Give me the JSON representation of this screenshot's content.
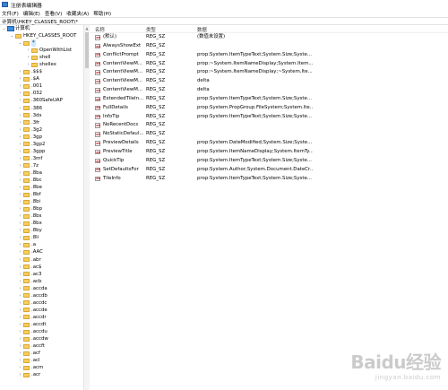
{
  "window": {
    "title": "注册表编辑器"
  },
  "menu": [
    "文件(F)",
    "编辑(E)",
    "查看(V)",
    "收藏夹(A)",
    "帮助(H)"
  ],
  "address": "计算机\\HKEY_CLASSES_ROOT\\*",
  "tree": [
    {
      "label": "计算机",
      "indent": 0,
      "expanded": true,
      "icon": "computer"
    },
    {
      "label": "HKEY_CLASSES_ROOT",
      "indent": 1,
      "expanded": true,
      "icon": "folder"
    },
    {
      "label": "*",
      "indent": 2,
      "expanded": true,
      "icon": "folder",
      "selected": true
    },
    {
      "label": "OpenWithList",
      "indent": 3,
      "expanded": false,
      "icon": "folder"
    },
    {
      "label": "shell",
      "indent": 3,
      "expanded": false,
      "icon": "folder"
    },
    {
      "label": "shellex",
      "indent": 3,
      "expanded": false,
      "icon": "folder"
    },
    {
      "label": ".$$$",
      "indent": 2,
      "expanded": false,
      "icon": "folder"
    },
    {
      "label": ".$A",
      "indent": 2,
      "expanded": false,
      "icon": "folder"
    },
    {
      "label": ".001",
      "indent": 2,
      "expanded": false,
      "icon": "folder"
    },
    {
      "label": ".032",
      "indent": 2,
      "expanded": false,
      "icon": "folder"
    },
    {
      "label": ".360SafeUAP",
      "indent": 2,
      "expanded": false,
      "icon": "folder"
    },
    {
      "label": ".386",
      "indent": 2,
      "expanded": false,
      "icon": "folder"
    },
    {
      "label": ".3ds",
      "indent": 2,
      "expanded": false,
      "icon": "folder"
    },
    {
      "label": ".3fr",
      "indent": 2,
      "expanded": false,
      "icon": "folder"
    },
    {
      "label": ".3g2",
      "indent": 2,
      "expanded": false,
      "icon": "folder"
    },
    {
      "label": ".3gp",
      "indent": 2,
      "expanded": false,
      "icon": "folder"
    },
    {
      "label": ".3gp2",
      "indent": 2,
      "expanded": false,
      "icon": "folder"
    },
    {
      "label": ".3gpp",
      "indent": 2,
      "expanded": false,
      "icon": "folder"
    },
    {
      "label": ".3mf",
      "indent": 2,
      "expanded": false,
      "icon": "folder"
    },
    {
      "label": ".7z",
      "indent": 2,
      "expanded": false,
      "icon": "folder"
    },
    {
      "label": ".8ba",
      "indent": 2,
      "expanded": false,
      "icon": "folder"
    },
    {
      "label": ".8bc",
      "indent": 2,
      "expanded": false,
      "icon": "folder"
    },
    {
      "label": ".8be",
      "indent": 2,
      "expanded": false,
      "icon": "folder"
    },
    {
      "label": ".8bf",
      "indent": 2,
      "expanded": false,
      "icon": "folder"
    },
    {
      "label": ".8bi",
      "indent": 2,
      "expanded": false,
      "icon": "folder"
    },
    {
      "label": ".8bp",
      "indent": 2,
      "expanded": false,
      "icon": "folder"
    },
    {
      "label": ".8bs",
      "indent": 2,
      "expanded": false,
      "icon": "folder"
    },
    {
      "label": ".8bx",
      "indent": 2,
      "expanded": false,
      "icon": "folder"
    },
    {
      "label": ".8by",
      "indent": 2,
      "expanded": false,
      "icon": "folder"
    },
    {
      "label": ".8li",
      "indent": 2,
      "expanded": false,
      "icon": "folder"
    },
    {
      "label": ".a",
      "indent": 2,
      "expanded": false,
      "icon": "folder"
    },
    {
      "label": ".AAC",
      "indent": 2,
      "expanded": false,
      "icon": "folder"
    },
    {
      "label": ".abr",
      "indent": 2,
      "expanded": false,
      "icon": "folder"
    },
    {
      "label": ".ac$",
      "indent": 2,
      "expanded": false,
      "icon": "folder"
    },
    {
      "label": ".ac3",
      "indent": 2,
      "expanded": false,
      "icon": "folder"
    },
    {
      "label": ".acb",
      "indent": 2,
      "expanded": false,
      "icon": "folder"
    },
    {
      "label": ".accda",
      "indent": 2,
      "expanded": false,
      "icon": "folder"
    },
    {
      "label": ".accdb",
      "indent": 2,
      "expanded": false,
      "icon": "folder"
    },
    {
      "label": ".accdc",
      "indent": 2,
      "expanded": false,
      "icon": "folder"
    },
    {
      "label": ".accde",
      "indent": 2,
      "expanded": false,
      "icon": "folder"
    },
    {
      "label": ".accdr",
      "indent": 2,
      "expanded": false,
      "icon": "folder"
    },
    {
      "label": ".accdt",
      "indent": 2,
      "expanded": false,
      "icon": "folder"
    },
    {
      "label": ".accdu",
      "indent": 2,
      "expanded": false,
      "icon": "folder"
    },
    {
      "label": ".accdw",
      "indent": 2,
      "expanded": false,
      "icon": "folder"
    },
    {
      "label": ".accft",
      "indent": 2,
      "expanded": false,
      "icon": "folder"
    },
    {
      "label": ".acf",
      "indent": 2,
      "expanded": false,
      "icon": "folder"
    },
    {
      "label": ".acl",
      "indent": 2,
      "expanded": false,
      "icon": "folder"
    },
    {
      "label": ".acm",
      "indent": 2,
      "expanded": false,
      "icon": "folder"
    },
    {
      "label": ".acr",
      "indent": 2,
      "expanded": false,
      "icon": "folder"
    }
  ],
  "columns": {
    "name": "名称",
    "type": "类型",
    "data": "数据"
  },
  "values": [
    {
      "name": "(默认)",
      "type": "REG_SZ",
      "data": "(数值未设置)"
    },
    {
      "name": "AlwaysShowExt",
      "type": "REG_SZ",
      "data": ""
    },
    {
      "name": "ConflictPrompt",
      "type": "REG_SZ",
      "data": "prop:System.ItemTypeText;System.Size;Syste..."
    },
    {
      "name": "ContentViewM...",
      "type": "REG_SZ",
      "data": "prop:~System.ItemNameDisplay;System.Item..."
    },
    {
      "name": "ContentViewM...",
      "type": "REG_SZ",
      "data": "prop:~System.ItemNameDisplay;~System.Ite..."
    },
    {
      "name": "ContentViewM...",
      "type": "REG_SZ",
      "data": "delta"
    },
    {
      "name": "ContentViewM...",
      "type": "REG_SZ",
      "data": "delta"
    },
    {
      "name": "ExtendedTileIn...",
      "type": "REG_SZ",
      "data": "prop:System.ItemTypeText;System.Size;Syste..."
    },
    {
      "name": "FullDetails",
      "type": "REG_SZ",
      "data": "prop:System.PropGroup.FileSystem;System.Ite..."
    },
    {
      "name": "InfoTip",
      "type": "REG_SZ",
      "data": "prop:System.ItemTypeText;System.Size;Syste..."
    },
    {
      "name": "NoRecentDocs",
      "type": "REG_SZ",
      "data": ""
    },
    {
      "name": "NoStaticDefaul...",
      "type": "REG_SZ",
      "data": ""
    },
    {
      "name": "PreviewDetails",
      "type": "REG_SZ",
      "data": "prop:System.DateModified;System.Size;Syste..."
    },
    {
      "name": "PreviewTitle",
      "type": "REG_SZ",
      "data": "prop:System.ItemNameDisplay;System.ItemTy..."
    },
    {
      "name": "QuickTip",
      "type": "REG_SZ",
      "data": "prop:System.ItemTypeText;System.Size;Syste..."
    },
    {
      "name": "SetDefaultsFor",
      "type": "REG_SZ",
      "data": "prop:System.Author;System.Document.DateCr..."
    },
    {
      "name": "TileInfo",
      "type": "REG_SZ",
      "data": "prop:System.ItemTypeText;System.Size;Syste..."
    }
  ],
  "watermark": {
    "main": "Baidu经验",
    "sub": "jingyan.baidu.com"
  }
}
